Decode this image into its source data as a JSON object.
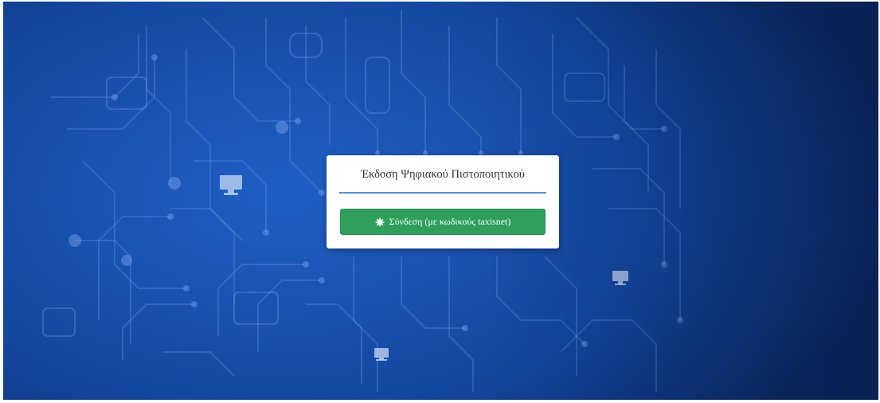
{
  "dialog": {
    "title": "Έκδοση Ψηφιακού Πιστοποιητικού",
    "login_button_label": "Σύνδεση (με κωδικούς taxisnet)",
    "login_button_icon": "cog-icon"
  },
  "colors": {
    "background": "#14479f",
    "card": "#ffffff",
    "underline": "#4a90e2",
    "button": "#2ea05b",
    "button_text": "#ffffff"
  }
}
